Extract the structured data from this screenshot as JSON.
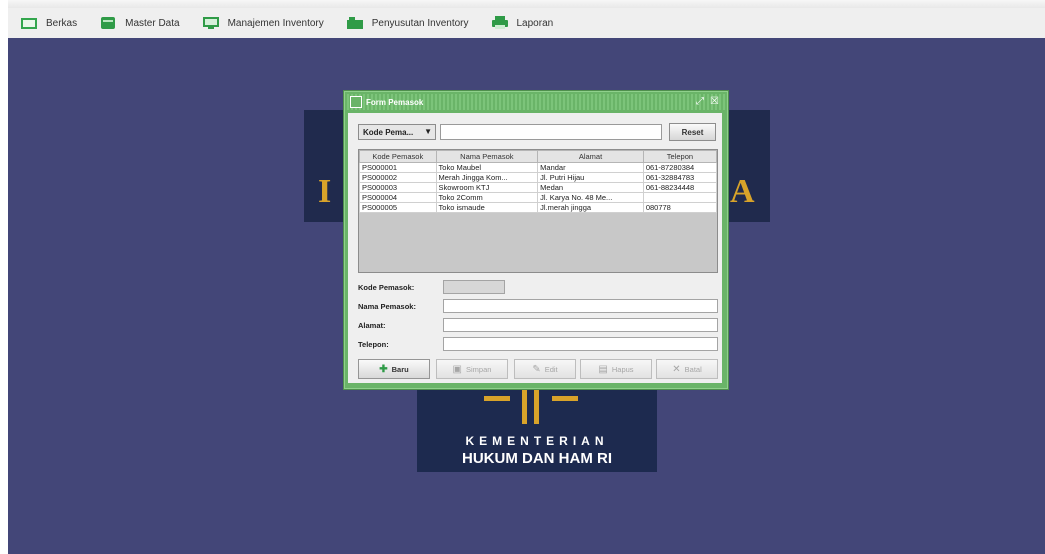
{
  "menu": [
    {
      "label": "Berkas",
      "icon": "folder-icon"
    },
    {
      "label": "Master Data",
      "icon": "database-icon"
    },
    {
      "label": "Manajemen Inventory",
      "icon": "monitor-icon"
    },
    {
      "label": "Penyusutan Inventory",
      "icon": "bar-chart-icon"
    },
    {
      "label": "Laporan",
      "icon": "printer-icon"
    }
  ],
  "background_logo": {
    "line1": "KEMENTERIAN",
    "line2": "HUKUM DAN HAM RI",
    "colors": {
      "band": "#202a4d",
      "gold": "#d8a32a"
    }
  },
  "dialog": {
    "title": "Form Pemasok",
    "search": {
      "combo_value": "Kode Pema...",
      "query": "",
      "reset_label": "Reset"
    },
    "table": {
      "columns": [
        "Kode Pemasok",
        "Nama Pemasok",
        "Alamat",
        "Telepon"
      ],
      "rows": [
        [
          "PS000001",
          "Toko Maubel",
          "Mandar",
          "061-87280384"
        ],
        [
          "PS000002",
          "Merah Jingga Kom...",
          "Jl. Putri Hijau",
          "061-32884783"
        ],
        [
          "PS000003",
          "Skowroom KTJ",
          "Medan",
          "061-88234448"
        ],
        [
          "PS000004",
          "Toko 2Comm",
          "Jl. Karya No. 48 Me...",
          ""
        ],
        [
          "PS000005",
          "Toko ismaude",
          "Jl.merah jingga",
          "080778"
        ]
      ]
    },
    "form": {
      "kode_label": "Kode Pemasok:",
      "kode_value": "",
      "nama_label": "Nama Pemasok:",
      "nama_value": "",
      "alamat_label": "Alamat:",
      "alamat_value": "",
      "telepon_label": "Telepon:",
      "telepon_value": ""
    },
    "buttons": {
      "baru": "Baru",
      "simpan": "Simpan",
      "edit": "Edit",
      "hapus": "Hapus",
      "batal": "Batal"
    }
  },
  "colors": {
    "frame": "#6ab468",
    "desktop": "#434678"
  }
}
